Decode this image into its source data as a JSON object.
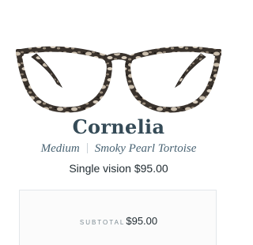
{
  "product": {
    "name": "Cornelia",
    "width": "Medium",
    "color": "Smoky Pearl Tortoise",
    "lens_price": "Single vision $95.00"
  },
  "summary": {
    "subtotal_label": "SUBTOTAL",
    "subtotal_value": "$95.00"
  },
  "icons": {
    "product_image": "eyeglasses-image"
  },
  "colors": {
    "frame_dark": "#2b2622",
    "frame_light": "#c9bba6",
    "title": "#354b57",
    "subtitle": "#4a6474"
  }
}
